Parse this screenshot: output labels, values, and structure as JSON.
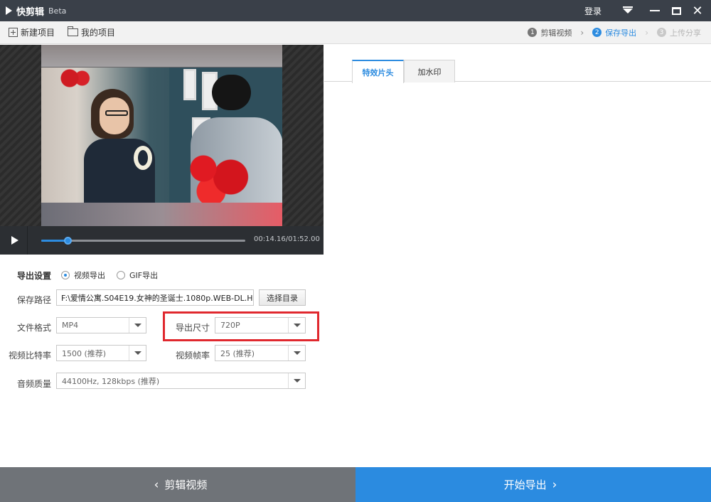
{
  "app": {
    "name": "快剪辑",
    "badge": "Beta"
  },
  "titlebar": {
    "login_label": "登录"
  },
  "toolbar": {
    "new_project": "新建项目",
    "my_projects": "我的项目",
    "steps": [
      {
        "num": "1",
        "label": "剪辑视频"
      },
      {
        "num": "2",
        "label": "保存导出"
      },
      {
        "num": "3",
        "label": "上传分享"
      }
    ]
  },
  "player": {
    "current_time": "00:14.16",
    "total_time": "01:52.00",
    "time_display": "00:14.16/01:52.00",
    "progress": 0.13
  },
  "export": {
    "section_label": "导出设置",
    "mode_video": "视频导出",
    "mode_gif": "GIF导出",
    "selected_mode": "视频导出",
    "save_path_label": "保存路径",
    "save_path_value": "F:\\爱情公寓.S04E19.女神的圣诞士.1080p.WEB-DL.H.",
    "choose_dir_button": "选择目录",
    "format_label": "文件格式",
    "format_value": "MP4",
    "size_label": "导出尺寸",
    "size_value": "720P",
    "bitrate_label": "视频比特率",
    "bitrate_value": "1500 (推荐)",
    "framerate_label": "视频帧率",
    "framerate_value": "25 (推荐)",
    "audio_label": "音频质量",
    "audio_value": "44100Hz, 128kbps (推荐)"
  },
  "right_panel": {
    "tabs": [
      {
        "label": "特效片头"
      },
      {
        "label": "加水印"
      }
    ],
    "active_tab": "特效片头"
  },
  "footer": {
    "back_label": "剪辑视频",
    "start_label": "开始导出"
  },
  "colors": {
    "accent": "#2d8ce0",
    "titlebar": "#3a4049",
    "highlight": "#e0282e",
    "footer_back": "#6f7378",
    "footer_start": "#2b8be0"
  }
}
